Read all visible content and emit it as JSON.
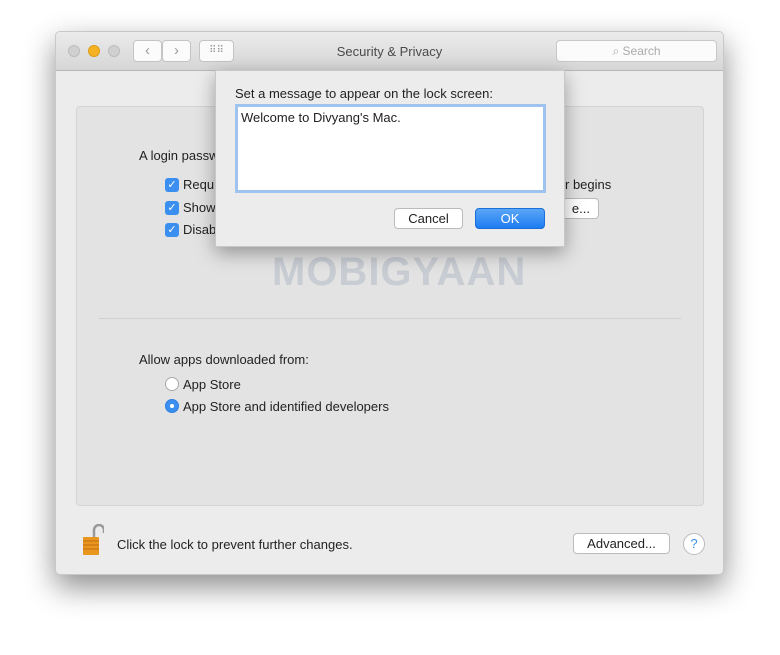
{
  "window": {
    "title": "Security & Privacy",
    "search_placeholder": "Search"
  },
  "general": {
    "login_label": "A login passw",
    "checkboxes": [
      {
        "label": "Requi",
        "checked": true
      },
      {
        "label": "Show",
        "checked": true
      },
      {
        "label": "Disab",
        "checked": true
      }
    ],
    "right_text": "r begins",
    "right_button": "e..."
  },
  "allow": {
    "label": "Allow apps downloaded from:",
    "options": [
      {
        "label": "App Store",
        "selected": false
      },
      {
        "label": "App Store and identified developers",
        "selected": true
      }
    ]
  },
  "footer": {
    "lock_text": "Click the lock to prevent further changes.",
    "advanced": "Advanced...",
    "help": "?"
  },
  "dialog": {
    "prompt": "Set a message to appear on the lock screen:",
    "message": "Welcome to Divyang's Mac.",
    "cancel": "Cancel",
    "ok": "OK"
  },
  "watermark": "MOBIGYAAN",
  "colors": {
    "accent": "#3b8ff0",
    "lock": "#e8961e"
  }
}
